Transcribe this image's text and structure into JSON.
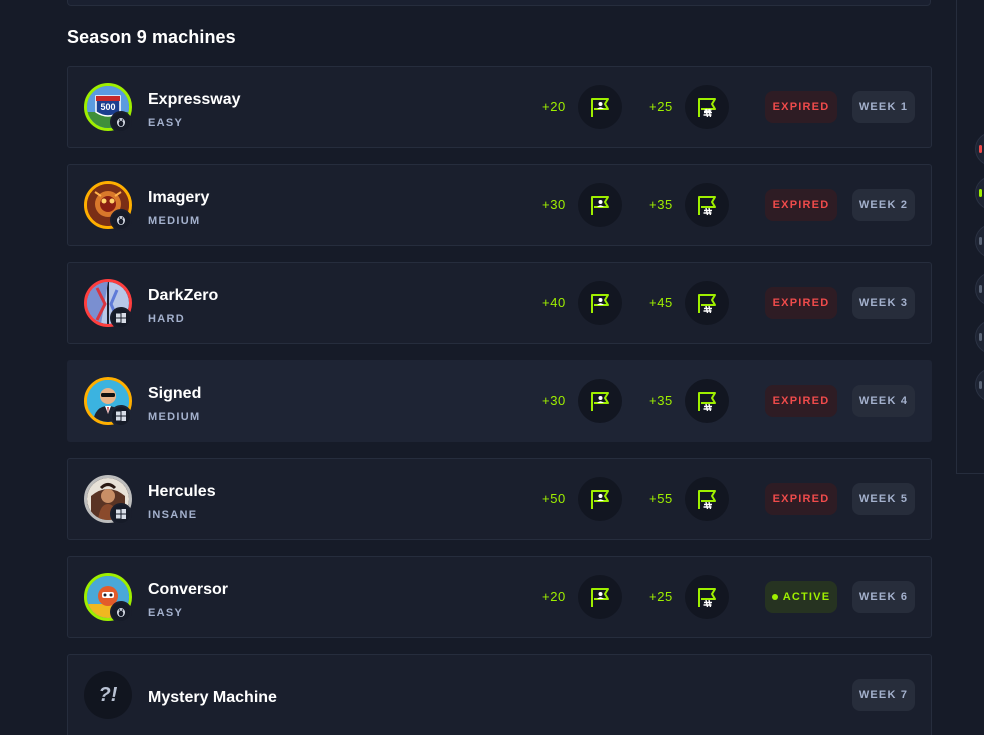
{
  "section": {
    "title": "Season 9 machines"
  },
  "machines": [
    {
      "name": "Expressway",
      "difficulty": "EASY",
      "os": "linux",
      "user_points": "+20",
      "root_points": "+25",
      "status": "EXPIRED",
      "week": "WEEK 1",
      "ring_color": "#9fef00"
    },
    {
      "name": "Imagery",
      "difficulty": "MEDIUM",
      "os": "linux",
      "user_points": "+30",
      "root_points": "+35",
      "status": "EXPIRED",
      "week": "WEEK 2",
      "ring_color": "#ffaf00"
    },
    {
      "name": "DarkZero",
      "difficulty": "HARD",
      "os": "windows",
      "user_points": "+40",
      "root_points": "+45",
      "status": "EXPIRED",
      "week": "WEEK 3",
      "ring_color": "#ff3e3e"
    },
    {
      "name": "Signed",
      "difficulty": "MEDIUM",
      "os": "windows",
      "user_points": "+30",
      "root_points": "+35",
      "status": "EXPIRED",
      "week": "WEEK 4",
      "ring_color": "#ffaf00"
    },
    {
      "name": "Hercules",
      "difficulty": "INSANE",
      "os": "windows",
      "user_points": "+50",
      "root_points": "+55",
      "status": "EXPIRED",
      "week": "WEEK 5",
      "ring_color": "#bdbdbd"
    },
    {
      "name": "Conversor",
      "difficulty": "EASY",
      "os": "linux",
      "user_points": "+20",
      "root_points": "+25",
      "status": "ACTIVE",
      "week": "WEEK 6",
      "ring_color": "#9fef00"
    }
  ],
  "mystery": {
    "icon_text": "?!",
    "name": "Mystery Machine",
    "week": "WEEK 7"
  },
  "icons": {
    "user_flag": "user-flag-icon",
    "root_flag": "root-flag-icon",
    "linux": "linux-penguin-icon",
    "windows": "windows-icon",
    "mystery": "mystery-icon"
  },
  "colors": {
    "accent_green": "#9fef00",
    "expired_red": "#ef4b4b",
    "background": "#161b28",
    "row_background": "#1a1f2d",
    "muted_text": "#a4b1cd"
  }
}
